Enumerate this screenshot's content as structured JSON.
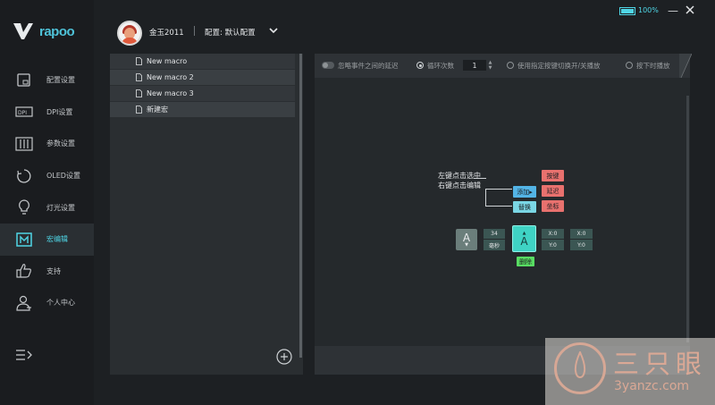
{
  "app": {
    "brand": "rapoo"
  },
  "sidebar": {
    "items": [
      {
        "label": "配置设置",
        "icon": "config-icon"
      },
      {
        "label": "DPI设置",
        "icon": "dpi-icon"
      },
      {
        "label": "参数设置",
        "icon": "params-icon"
      },
      {
        "label": "OLED设置",
        "icon": "oled-icon"
      },
      {
        "label": "灯光设置",
        "icon": "light-icon"
      },
      {
        "label": "宏编辑",
        "icon": "macro-icon",
        "active": true
      },
      {
        "label": "支持",
        "icon": "thumbs-up-icon"
      },
      {
        "label": "个人中心",
        "icon": "user-icon"
      }
    ],
    "bottom_icon": "collapse-menu-icon"
  },
  "header": {
    "user_name": "金玉2011",
    "profile_label": "配置: 默认配置",
    "battery": "100%"
  },
  "macros": {
    "items": [
      "New macro",
      "New macro 2",
      "New macro 3",
      "新建宏"
    ]
  },
  "editor": {
    "toolbar": {
      "ignore_delay": "忽略事件之间的延迟",
      "loop_count": "循环次数",
      "loop_value": "1",
      "toggle_repeat": "使用指定按键切换开/关播放",
      "hold_play": "按下时播放"
    },
    "hint_line1": "左键点击选中",
    "hint_line2": "右键点击编辑",
    "popup": {
      "add": "添加",
      "replace": "替换",
      "key": "按键",
      "delay": "延迟",
      "coord": "坐标",
      "delete": "删除"
    },
    "nodes": {
      "key1": "A",
      "delay_value": "34",
      "delay_unit": "毫秒",
      "key2": "A",
      "coord1_x": "X:0",
      "coord1_y": "Y:0",
      "coord2_x": "X:0",
      "coord2_y": "Y:0"
    }
  },
  "watermark": {
    "big": "三只眼",
    "small": "3yanzc.com"
  },
  "colors": {
    "accent": "#4fd6e6",
    "background": "#1d2023"
  }
}
